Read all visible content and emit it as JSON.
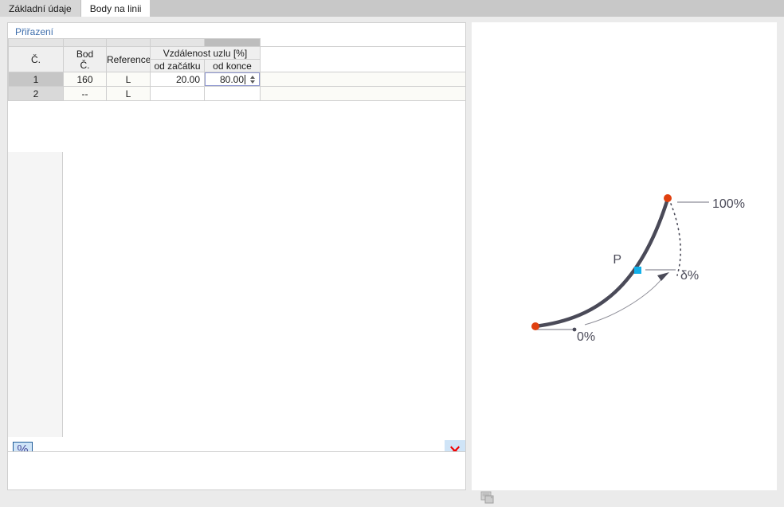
{
  "tabs": [
    {
      "label": "Základní údaje",
      "active": false
    },
    {
      "label": "Body na linii",
      "active": true
    }
  ],
  "group": {
    "title": "Přiřazení"
  },
  "table": {
    "headers": {
      "no": "Č.",
      "point_line1": "Bod",
      "point_line2": "Č.",
      "reference": "Reference",
      "distance_group": "Vzdálenost uzlu [%]",
      "from_start": "od začátku",
      "from_end": "od konce"
    },
    "rows": [
      {
        "no": "1",
        "point": "160",
        "reference": "L",
        "from_start": "20.00",
        "from_end": "80.00",
        "editing": true
      },
      {
        "no": "2",
        "point": "--",
        "reference": "L",
        "from_start": "",
        "from_end": "",
        "editing": false
      }
    ]
  },
  "toolbar": {
    "percent_label": "%",
    "percent_icon": "percent-icon",
    "delete_icon": "red-cross-delete-icon"
  },
  "diagram": {
    "label_100": "100%",
    "label_delta": "δ%",
    "label_0": "0%",
    "label_point": "P",
    "copy_icon": "copy-icon",
    "colors": {
      "curve": "#4a4a58",
      "endpoint": "#e0400f",
      "point": "#11b0ea",
      "leader": "#8c8c96",
      "text": "#4a4a58"
    }
  }
}
